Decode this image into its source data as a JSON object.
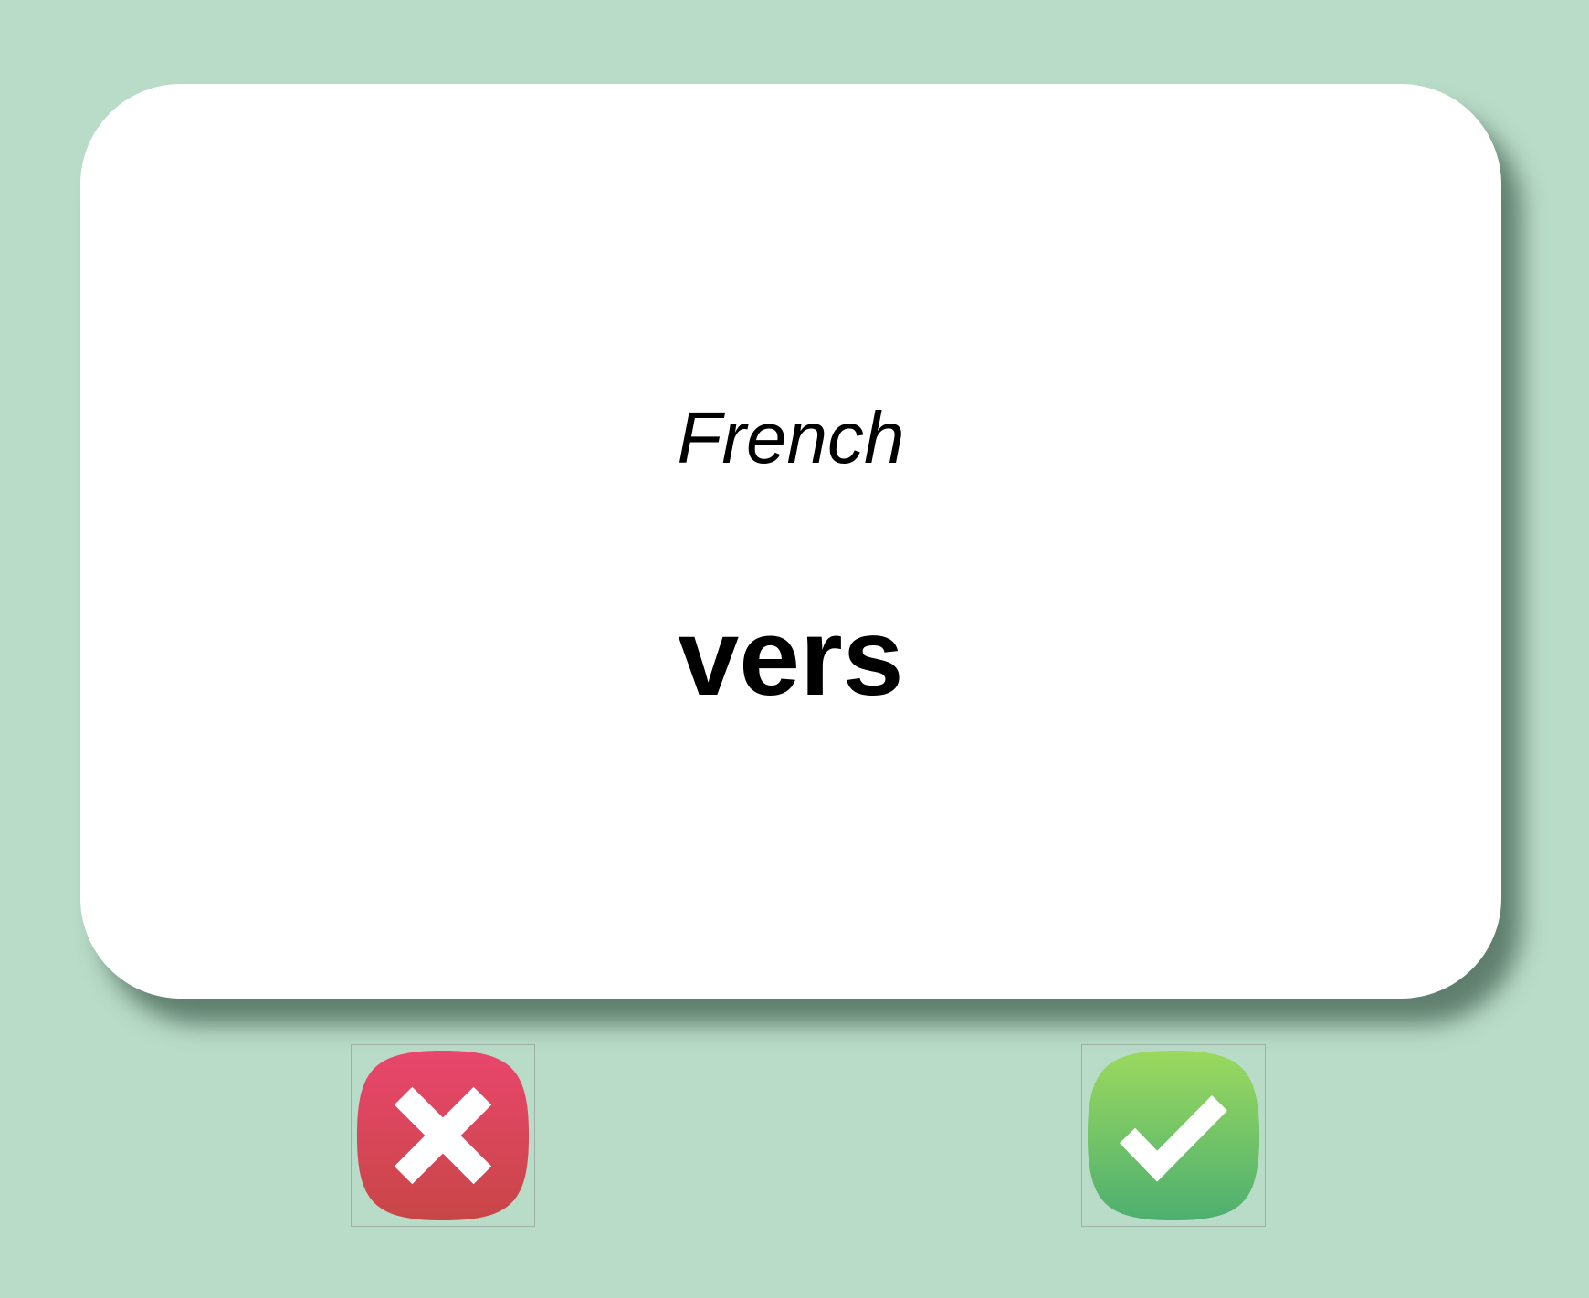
{
  "card": {
    "language_label": "French",
    "word": "vers"
  },
  "actions": {
    "wrong": {
      "icon": "close-icon",
      "color_top": "#e9466d",
      "color_bottom": "#c84646"
    },
    "correct": {
      "icon": "check-icon",
      "color_top": "#9bd95e",
      "color_bottom": "#4daf70"
    }
  },
  "colors": {
    "background": "#b9dcc8",
    "card": "#ffffff"
  }
}
